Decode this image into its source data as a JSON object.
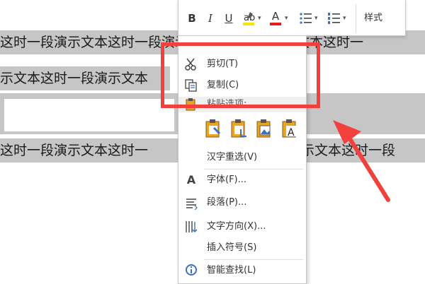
{
  "document": {
    "line1": "这时一段演示文本这时一段演示文本这时一段演示文本这时一",
    "line2": "示文本这时一段演示文本",
    "line3_left": "这时一段演示文本这时一",
    "line3_right": "段演示文本这时一段"
  },
  "toolbar": {
    "bold": "B",
    "italic": "I",
    "underline": "U",
    "font_color_letter": "A",
    "styles": "样式"
  },
  "context_menu": {
    "cut": "剪切(T)",
    "copy": "复制(C)",
    "paste_options": "粘贴选项:",
    "chinese_reconvert": "汉字重选(V)",
    "font": "字体(F)...",
    "paragraph": "段落(P)...",
    "text_direction": "文字方向(X)...",
    "insert_symbol": "插入符号(S)",
    "smart_lookup": "智能查找(L)"
  },
  "colors": {
    "highlight": "#c6c6c6",
    "annotation_red": "#f2403c",
    "font_color_bar": "#e81c1c",
    "highlight_color_bar": "#f4e600",
    "paste_icon": "#e9a426"
  }
}
